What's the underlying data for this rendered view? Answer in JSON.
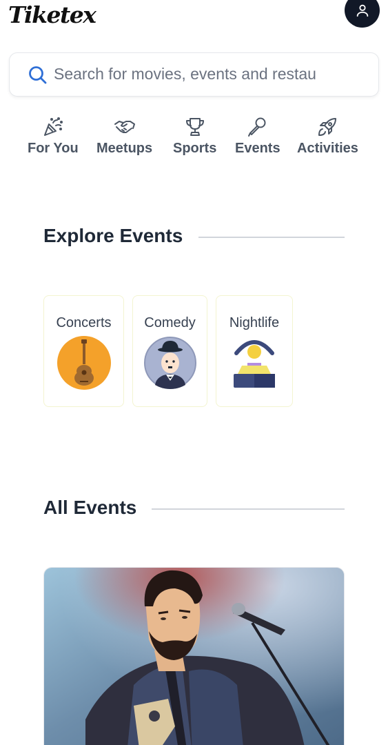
{
  "header": {
    "logo_text": "Tiketex",
    "profile_icon": "user-icon"
  },
  "search": {
    "placeholder": "Search for movies, events and restau",
    "icon": "search-icon"
  },
  "categories": [
    {
      "label": "For You",
      "icon": "party-popper-icon"
    },
    {
      "label": "Meetups",
      "icon": "handshake-icon"
    },
    {
      "label": "Sports",
      "icon": "trophy-icon"
    },
    {
      "label": "Events",
      "icon": "microphone-icon"
    },
    {
      "label": "Activities",
      "icon": "rocket-icon"
    }
  ],
  "explore": {
    "title": "Explore Events",
    "items": [
      {
        "label": "Concerts",
        "icon": "guitar-icon"
      },
      {
        "label": "Comedy",
        "icon": "comedian-icon"
      },
      {
        "label": "Nightlife",
        "icon": "dj-icon"
      }
    ]
  },
  "all_events": {
    "title": "All Events",
    "cards": [
      {
        "image": "singer-performing-photo"
      }
    ]
  },
  "colors": {
    "accent_blue": "#2f6fd6",
    "text_dark": "#1f2937",
    "concert_orange": "#f4a12a",
    "comedy_circle": "#a9b3d1",
    "nightlife_navy": "#3c4a7c",
    "avatar_bg": "#111827"
  }
}
